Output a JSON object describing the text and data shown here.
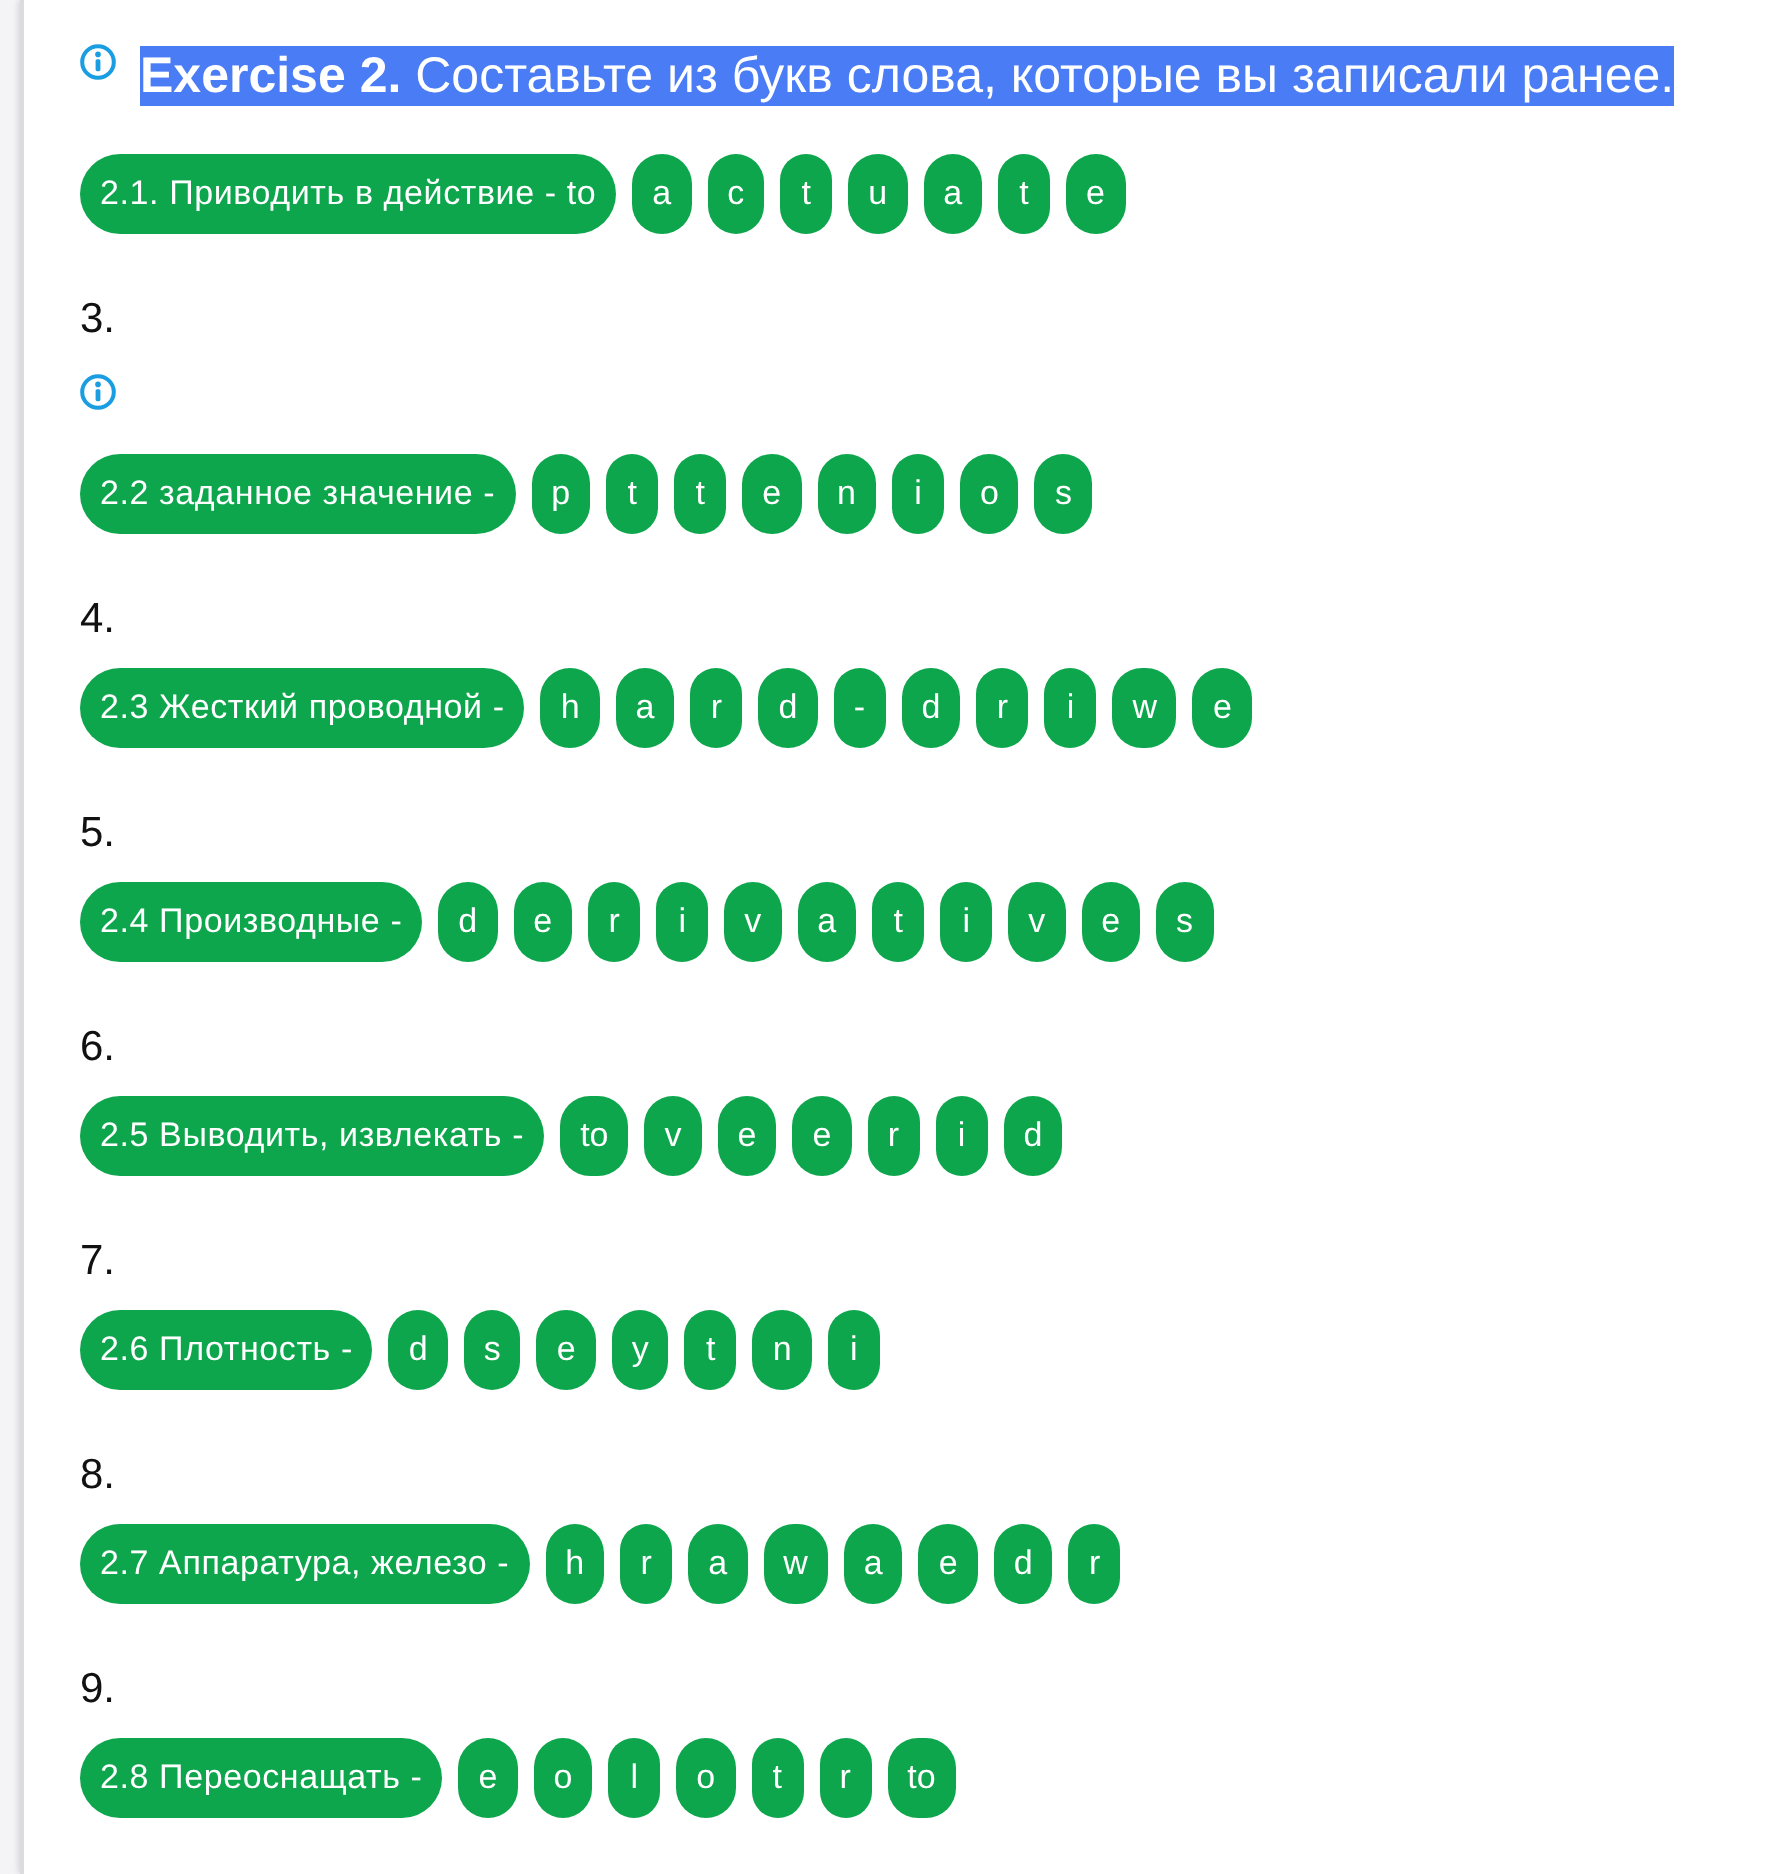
{
  "questions": [
    {
      "heading": "**Exercise 2.** Составьте из букв слова, которые вы записали ранее.",
      "highlighted": true,
      "info_icon": true,
      "prompt": "2.1. Приводить в действие - to",
      "letters": [
        "a",
        "c",
        "t",
        "u",
        "a",
        "t",
        "e"
      ]
    },
    {
      "number": "3.",
      "info_icon": true,
      "prompt": "2.2 заданное значение -",
      "letters": [
        "p",
        "t",
        "t",
        "e",
        "n",
        "i",
        "o",
        "s"
      ]
    },
    {
      "number": "4.",
      "info_icon": false,
      "prompt": "2.3 Жесткий проводной -",
      "letters": [
        "h",
        "a",
        "r",
        "d",
        "-",
        "d",
        "r",
        "i",
        "w",
        "e"
      ]
    },
    {
      "number": "5.",
      "info_icon": false,
      "prompt": "2.4 Производные -",
      "letters": [
        "d",
        "e",
        "r",
        "i",
        "v",
        "a",
        "t",
        "i",
        "v",
        "e",
        "s"
      ]
    },
    {
      "number": "6.",
      "info_icon": false,
      "prompt": "2.5 Выводить, извлекать -",
      "letters": [
        "to",
        "v",
        "e",
        "e",
        "r",
        "i",
        "d"
      ]
    },
    {
      "number": "7.",
      "info_icon": false,
      "prompt": "2.6 Плотность -",
      "letters": [
        "d",
        "s",
        "e",
        "y",
        "t",
        "n",
        "i"
      ]
    },
    {
      "number": "8.",
      "info_icon": false,
      "prompt": "2.7 Аппаратура, железо -",
      "letters": [
        "h",
        "r",
        "a",
        "w",
        "a",
        "e",
        "d",
        "r"
      ]
    },
    {
      "number": "9.",
      "info_icon": false,
      "prompt": "2.8 Переоснащать -",
      "letters": [
        "e",
        "o",
        "l",
        "o",
        "t",
        "r",
        "to"
      ]
    }
  ]
}
